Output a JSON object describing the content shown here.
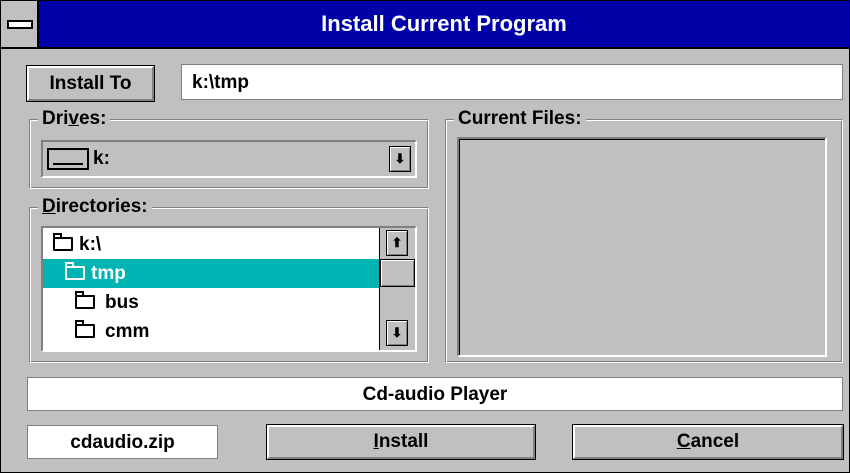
{
  "window": {
    "title": "Install Current Program"
  },
  "install_to": {
    "label": "Install To",
    "path": "k:\\tmp"
  },
  "drives": {
    "label_pre": "Dri",
    "label_accel": "v",
    "label_post": "es:",
    "selected": "k:"
  },
  "directories": {
    "label_accel": "D",
    "label_post": "irectories:",
    "items": [
      {
        "name": "k:\\",
        "icon": "open-folder-icon",
        "selected": false
      },
      {
        "name": "tmp",
        "icon": "open-folder-icon",
        "selected": true
      },
      {
        "name": "bus",
        "icon": "folder-icon",
        "selected": false
      },
      {
        "name": "cmm",
        "icon": "folder-icon",
        "selected": false
      }
    ]
  },
  "current_files": {
    "label": "Current Files:",
    "items": []
  },
  "program": {
    "name": "Cd-audio Player",
    "zip": "cdaudio.zip"
  },
  "buttons": {
    "install": {
      "accel": "I",
      "rest": "nstall"
    },
    "cancel": {
      "accel": "C",
      "rest": "ancel"
    }
  },
  "colors": {
    "titlebar": "#0000a8",
    "selection": "#00b4b4",
    "face": "#c0c0c0"
  }
}
